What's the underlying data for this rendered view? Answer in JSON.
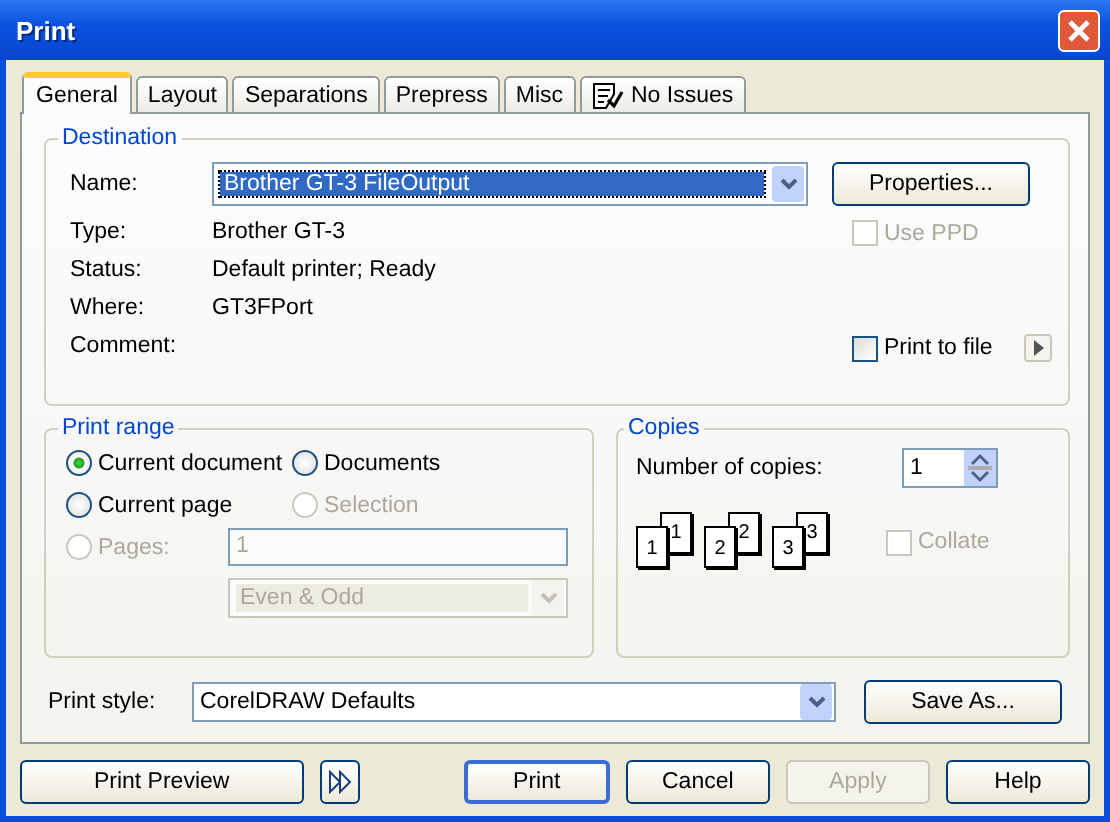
{
  "window": {
    "title": "Print"
  },
  "tabs": [
    {
      "label": "General",
      "selected": true,
      "kind": "text"
    },
    {
      "label": "Layout",
      "selected": false,
      "kind": "text"
    },
    {
      "label": "Separations",
      "selected": false,
      "kind": "text"
    },
    {
      "label": "Prepress",
      "selected": false,
      "kind": "text"
    },
    {
      "label": "Misc",
      "selected": false,
      "kind": "text"
    },
    {
      "label": "No Issues",
      "selected": false,
      "kind": "icon"
    }
  ],
  "destination": {
    "title": "Destination",
    "name_label": "Name:",
    "printer": "Brother GT-3 FileOutput",
    "properties_button": "Properties...",
    "info": [
      {
        "label": "Type:",
        "value": "Brother GT-3"
      },
      {
        "label": "Status:",
        "value": "Default printer; Ready"
      },
      {
        "label": "Where:",
        "value": "GT3FPort"
      },
      {
        "label": "Comment:"
      }
    ],
    "use_ppd": {
      "label": "Use PPD",
      "checked": false,
      "disabled": true
    },
    "print_to_file": {
      "label": "Print to file",
      "checked": false,
      "disabled": false
    }
  },
  "print_range": {
    "title": "Print range",
    "options": [
      {
        "label": "Current document",
        "selected": true,
        "disabled": false
      },
      {
        "label": "Documents",
        "selected": false,
        "disabled": false
      },
      {
        "label": "Current page",
        "selected": false,
        "disabled": false
      },
      {
        "label": "Selection",
        "selected": false,
        "disabled": true
      },
      {
        "label": "Pages:",
        "selected": false,
        "disabled": true
      }
    ],
    "pages_value": "1",
    "order_value": "Even & Odd"
  },
  "copies": {
    "title": "Copies",
    "label": "Number of copies:",
    "value": "1",
    "page_stacks": [
      {
        "back": "1",
        "front": "1"
      },
      {
        "back": "2",
        "front": "2"
      },
      {
        "back": "3",
        "front": "3"
      }
    ],
    "collate": {
      "label": "Collate",
      "checked": false,
      "disabled": true
    }
  },
  "print_style": {
    "label": "Print style:",
    "value": "CorelDRAW Defaults",
    "save_button": "Save As..."
  },
  "buttons": [
    {
      "label": "Print Preview",
      "disabled": false,
      "kind": "preview"
    },
    {
      "label": "Print",
      "disabled": false,
      "kind": "default"
    },
    {
      "label": "Cancel",
      "disabled": false,
      "kind": "normal"
    },
    {
      "label": "Apply",
      "disabled": true,
      "kind": "normal"
    },
    {
      "label": "Help",
      "disabled": false,
      "kind": "normal"
    }
  ]
}
